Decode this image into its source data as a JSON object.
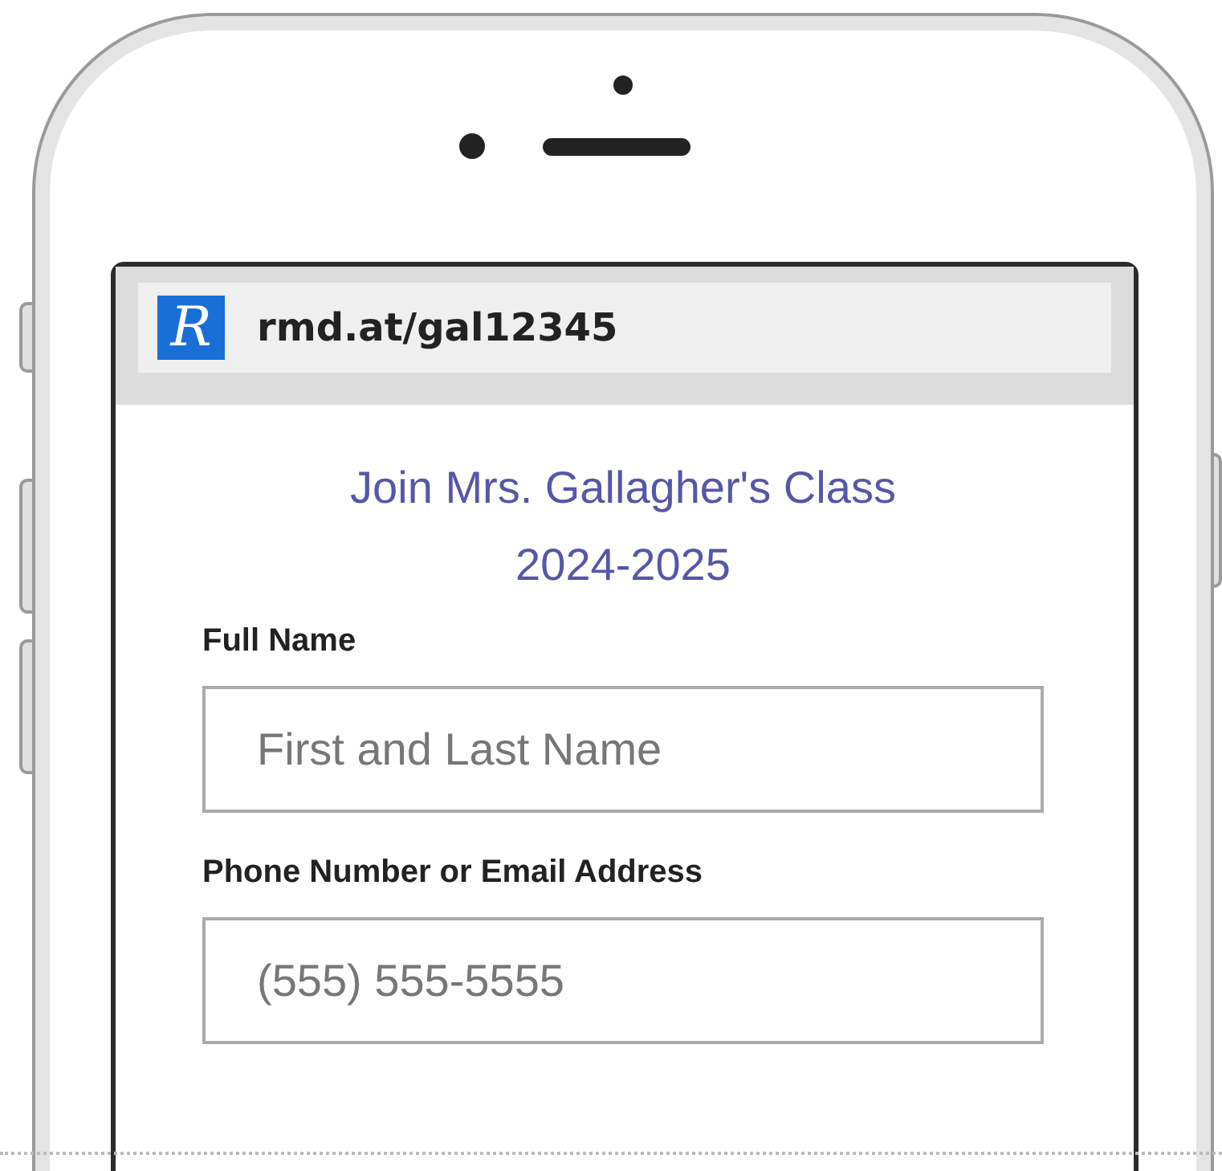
{
  "browser": {
    "logo_text": "R",
    "url": "rmd.at/gal12345"
  },
  "form": {
    "title_lines": [
      "Join Mrs. Gallagher's Class",
      "2024-2025"
    ],
    "fields": [
      {
        "label": "Full Name",
        "placeholder": "First and Last Name"
      },
      {
        "label": "Phone Number or Email Address",
        "placeholder": "(555) 555-5555"
      }
    ]
  }
}
